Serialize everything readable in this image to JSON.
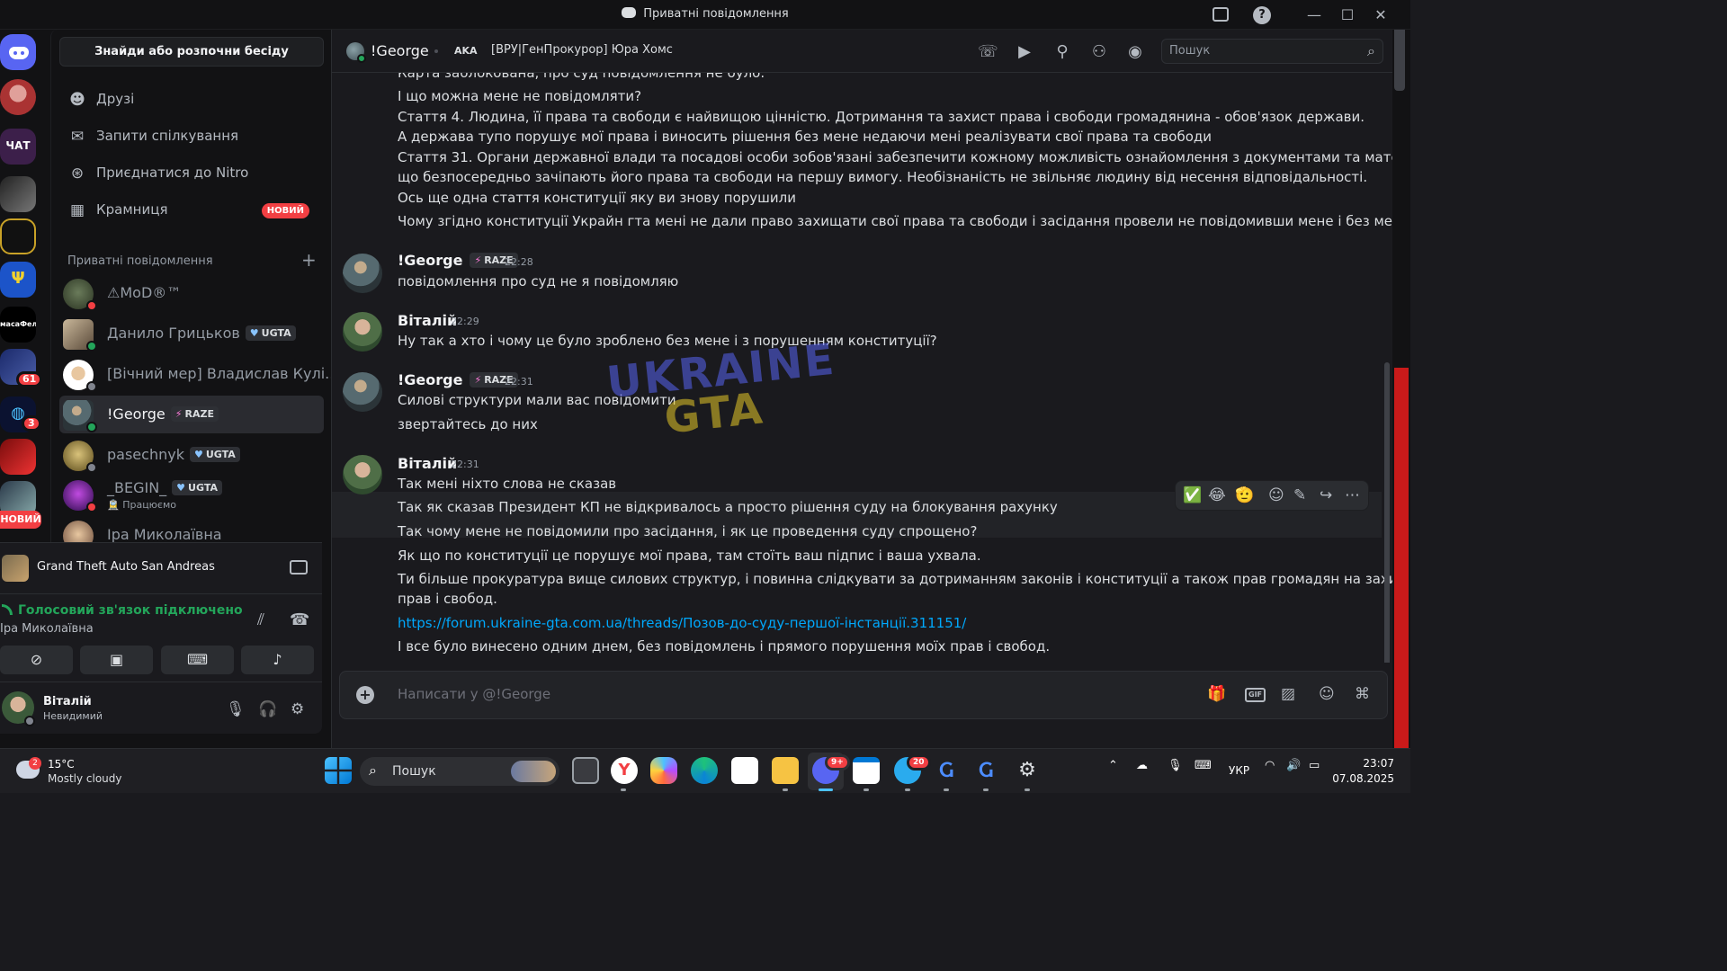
{
  "window": {
    "title": "Приватні повідомлення"
  },
  "sidebar": {
    "find_button": "Знайди або розпочни бесіду",
    "nav": [
      {
        "label": "Друзі",
        "icon": "friends-icon"
      },
      {
        "label": "Запити спілкування",
        "icon": "mail-icon"
      },
      {
        "label": "Приєднатися до Nitro",
        "icon": "nitro-icon"
      },
      {
        "label": "Крамниця",
        "icon": "shop-icon",
        "badge": "НОВИЙ"
      }
    ],
    "dm_header": "Приватні повідомлення",
    "dms": [
      {
        "name": "⚠MoD®™",
        "status": "dnd"
      },
      {
        "name": "Данило Грицьков",
        "tag": "UGTA",
        "status": "online"
      },
      {
        "name": "[Вічний мер] Владислав Кулі...",
        "status": "offline"
      },
      {
        "name": "!George",
        "tag": "RAZE",
        "status": "online",
        "active": true
      },
      {
        "name": "pasechnyk",
        "tag": "UGTA",
        "status": "offline"
      },
      {
        "name": "_BEGIN_",
        "tag": "UGTA",
        "sub": "🚊 Працюємо",
        "status": "dnd"
      },
      {
        "name": "Іра Миколаївна",
        "status": "online"
      }
    ]
  },
  "rail": {
    "servers": [
      "ЧАТ",
      "масаФел"
    ],
    "badges": [
      "61",
      "3"
    ],
    "new_label": "НОВИЙ"
  },
  "activity": {
    "game": "Grand Theft Auto San Andreas"
  },
  "voice": {
    "status": "Голосовий зв'язок підключено",
    "channel": "Іра Миколаївна"
  },
  "user": {
    "name": "Віталій",
    "status": "Невидимий"
  },
  "chat": {
    "header": {
      "name": "!George",
      "aka_label": "AKA",
      "aka_value": "[ВРУ|ГенПрокурор] Юра Хомс"
    },
    "search_placeholder": "Пошук",
    "composer_placeholder": "Написати у @!George",
    "top_lines": [
      "Карта заблокована, про суд повідомлення не було.",
      "І що можна мене не повідомляти?",
      "Стаття 4. Людина, її права та свободи є найвищою цінністю. Дотримання та захист права і свободи громадянина - обов'язок держави.",
      "А держава тупо порушує мої права і виносить рішення без мене недаючи мені реалізувати свої права та свободи",
      "Стаття 31. Органи державної влади та посадові особи зобов'язані забезпечити кожному можливість ознайомлення з документами та матеріалами,",
      "що безпосередньо зачіпають його права та свободи на першу вимогу. Необізнаність не звільняє людину від несення відповідальності.",
      "Ось  ще одна стаття конституції яку ви знову порушили",
      "Чому згідно конституції Украйн гта мені не дали право захищати свої права та свободи і засідання провели не повідомивши мене і без мене?"
    ],
    "messages": [
      {
        "author": "!George",
        "tag": "RAZE",
        "time": "22:28",
        "lines": [
          "повідомлення про суд не я повідомляю"
        ]
      },
      {
        "author": "Віталій",
        "time": "22:29",
        "lines": [
          "Ну так а хто і чому це було зроблено без мене і з порушенням конституції?"
        ]
      },
      {
        "author": "!George",
        "tag": "RAZE",
        "time": "22:31",
        "lines": [
          "Силові структури мали вас повідомити",
          "звертайтесь до них"
        ]
      },
      {
        "author": "Віталій",
        "time": "22:31",
        "lines": [
          "Так мені ніхто слова не сказав",
          "Так як сказав Президент КП не відкривалось а просто рішення суду на блокування рахунку",
          "Так чому мене не повідомили про засідання, і як це проведення суду спрощено?",
          "Як що по конституції це порушує мої права, там стоїть ваш підпис і ваша ухвала.",
          "Ти більше прокуратура вище силових структур, і повинна слідкувати за дотриманням законів і конституції а також прав громадян на захист свої",
          "прав і свобод.",
          "https://forum.ukraine-gta.com.ua/threads/Позов-до-суду-першої-інстанції.311151/",
          "І все було винесено одним днем, без повідомлень і прямого порушення моїх прав і свобод."
        ]
      }
    ],
    "watermark": [
      "UKRAINE",
      "GTA"
    ]
  },
  "taskbar": {
    "weather": {
      "temp": "15°C",
      "desc": "Mostly cloudy",
      "badge": "2"
    },
    "search_label": "Пошук",
    "discord_badge": "9+",
    "telegram_badge": "20",
    "lang": "УКР",
    "time": "23:07",
    "date": "07.08.2025"
  }
}
